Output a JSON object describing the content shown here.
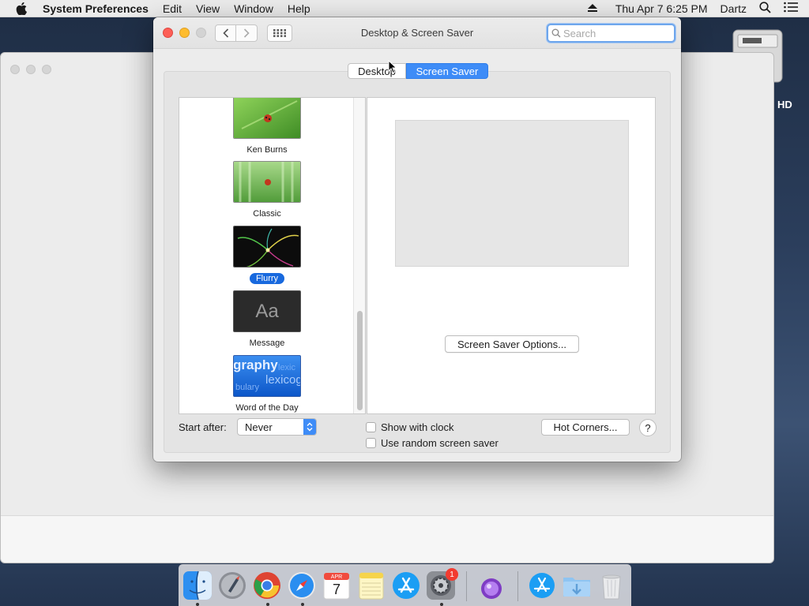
{
  "menubar": {
    "app_name": "System Preferences",
    "menus": [
      "Edit",
      "View",
      "Window",
      "Help"
    ],
    "datetime": "Thu Apr 7  6:25 PM",
    "user": "Dartz"
  },
  "desktop": {
    "disk_label": "HD"
  },
  "window": {
    "title": "Desktop & Screen Saver",
    "search_placeholder": "Search",
    "tabs": [
      "Desktop",
      "Screen Saver"
    ],
    "active_tab": "Screen Saver"
  },
  "savers": [
    {
      "label": "Ken Burns",
      "selected": false
    },
    {
      "label": "Classic",
      "selected": false
    },
    {
      "label": "Flurry",
      "selected": true
    },
    {
      "label": "Message",
      "selected": false,
      "thumb_text": "Aa"
    },
    {
      "label": "Word of the Day",
      "selected": false,
      "thumb_words": [
        "graphy",
        "lexicog",
        "bulary",
        "lexic"
      ]
    }
  ],
  "options_button": "Screen Saver Options...",
  "start_after": {
    "label": "Start after:",
    "value": "Never"
  },
  "checkboxes": [
    {
      "label": "Show with clock",
      "checked": false
    },
    {
      "label": "Use random screen saver",
      "checked": false
    }
  ],
  "hot_corners_button": "Hot Corners...",
  "help_button": "?",
  "dock": {
    "calendar_month": "APR",
    "calendar_day": "7",
    "sysprefs_badge": "1"
  },
  "colors": {
    "accent": "#3e8cf7",
    "selection": "#1869de"
  }
}
